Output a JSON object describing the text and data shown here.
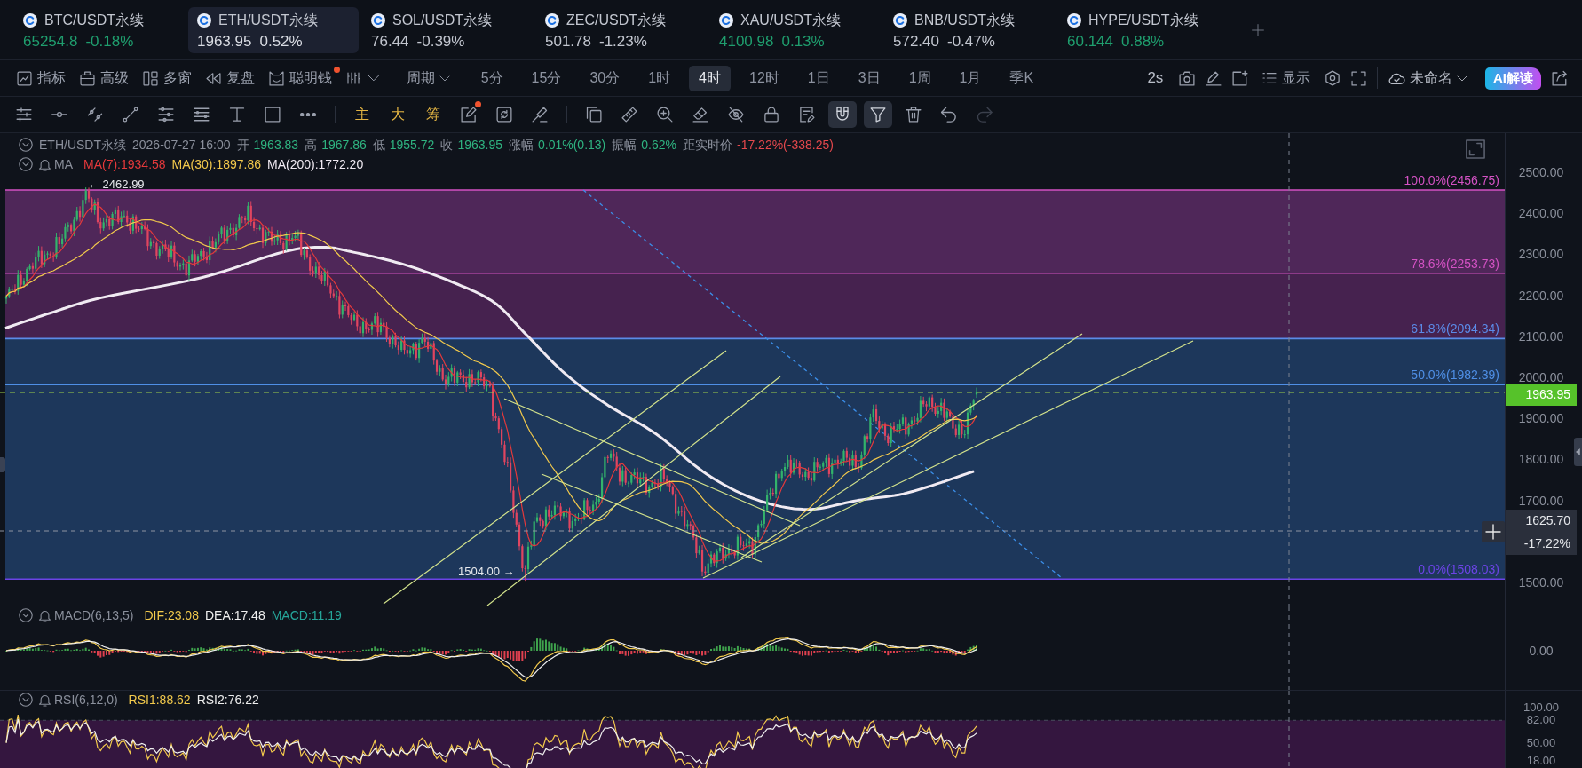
{
  "tickers": [
    {
      "symbol": "BTC/USDT永续",
      "price": "65254.8",
      "change": "-0.18%",
      "color": "#1f9e6e",
      "selected": false
    },
    {
      "symbol": "ETH/USDT永续",
      "price": "1963.95",
      "change": "0.52%",
      "color": "#d9dce3",
      "selected": true
    },
    {
      "symbol": "SOL/USDT永续",
      "price": "76.44",
      "change": "-0.39%",
      "color": "#c2c6cf",
      "selected": false
    },
    {
      "symbol": "ZEC/USDT永续",
      "price": "501.78",
      "change": "-1.23%",
      "color": "#c2c6cf",
      "selected": false
    },
    {
      "symbol": "XAU/USDT永续",
      "price": "4100.98",
      "change": "0.13%",
      "color": "#1f9e6e",
      "selected": false
    },
    {
      "symbol": "BNB/USDT永续",
      "price": "572.40",
      "change": "-0.47%",
      "color": "#c2c6cf",
      "selected": false
    },
    {
      "symbol": "HYPE/USDT永续",
      "price": "60.144",
      "change": "0.88%",
      "color": "#1f9e6e",
      "selected": false
    }
  ],
  "menu": [
    {
      "label": "指标",
      "dot": false
    },
    {
      "label": "高级",
      "dot": false
    },
    {
      "label": "多窗",
      "dot": false
    },
    {
      "label": "复盘",
      "dot": false
    },
    {
      "label": "聪明钱",
      "dot": true
    }
  ],
  "period_menu": {
    "label": "周期"
  },
  "periods": [
    {
      "label": "5分",
      "selected": false
    },
    {
      "label": "15分",
      "selected": false
    },
    {
      "label": "30分",
      "selected": false
    },
    {
      "label": "1时",
      "selected": false
    },
    {
      "label": "4时",
      "selected": true
    },
    {
      "label": "12时",
      "selected": false
    },
    {
      "label": "1日",
      "selected": false
    },
    {
      "label": "3日",
      "selected": false
    },
    {
      "label": "1周",
      "selected": false
    },
    {
      "label": "1月",
      "selected": false
    },
    {
      "label": "季K",
      "selected": false
    }
  ],
  "interval_button": {
    "label": "2s"
  },
  "display_button": {
    "label": "显示"
  },
  "layout_menu": {
    "label": "未命名"
  },
  "ai_button": {
    "label": "AI解读"
  },
  "tools": [
    {
      "kind": "icon",
      "on": false,
      "disabled": false,
      "dot": false
    },
    {
      "kind": "icon",
      "on": false,
      "disabled": false,
      "dot": false
    },
    {
      "kind": "icon",
      "on": false,
      "disabled": false,
      "dot": false
    },
    {
      "kind": "icon",
      "on": false,
      "disabled": false,
      "dot": false
    },
    {
      "kind": "icon",
      "on": false,
      "disabled": false,
      "dot": false
    },
    {
      "kind": "icon",
      "on": false,
      "disabled": false,
      "dot": false
    },
    {
      "kind": "icon",
      "on": false,
      "disabled": false,
      "dot": false
    },
    {
      "kind": "icon",
      "on": false,
      "disabled": false,
      "dot": false
    },
    {
      "kind": "icon",
      "on": false,
      "disabled": false,
      "dot": false
    },
    {
      "kind": "text",
      "label": "主",
      "on": false,
      "disabled": false,
      "dot": false
    },
    {
      "kind": "text",
      "label": "大",
      "on": false,
      "disabled": false,
      "dot": false
    },
    {
      "kind": "text",
      "label": "筹",
      "on": false,
      "disabled": false,
      "dot": false
    },
    {
      "kind": "icon",
      "on": false,
      "disabled": false,
      "dot": true
    },
    {
      "kind": "icon",
      "on": false,
      "disabled": false,
      "dot": false
    },
    {
      "kind": "icon",
      "on": false,
      "disabled": false,
      "dot": false
    },
    {
      "kind": "icon",
      "on": false,
      "disabled": false,
      "dot": false
    },
    {
      "kind": "icon",
      "on": false,
      "disabled": false,
      "dot": false
    },
    {
      "kind": "icon",
      "on": false,
      "disabled": false,
      "dot": false
    },
    {
      "kind": "icon",
      "on": false,
      "disabled": false,
      "dot": false
    },
    {
      "kind": "icon",
      "on": false,
      "disabled": false,
      "dot": false
    },
    {
      "kind": "icon",
      "on": false,
      "disabled": false,
      "dot": false
    },
    {
      "kind": "icon",
      "on": false,
      "disabled": false,
      "dot": false
    },
    {
      "kind": "icon",
      "on": true,
      "disabled": false,
      "dot": false
    },
    {
      "kind": "icon",
      "on": true,
      "disabled": false,
      "dot": false
    },
    {
      "kind": "icon",
      "on": false,
      "disabled": false,
      "dot": false
    },
    {
      "kind": "icon",
      "on": false,
      "disabled": false,
      "dot": false
    },
    {
      "kind": "icon",
      "on": false,
      "disabled": true,
      "dot": false
    }
  ],
  "legend": {
    "symbol": "ETH/USDT永续",
    "time": "2026-07-27 16:00",
    "fields": [
      {
        "label": "开",
        "value": "1963.83",
        "color": "#2fb380"
      },
      {
        "label": "高",
        "value": "1967.86",
        "color": "#2fb380"
      },
      {
        "label": "低",
        "value": "1955.72",
        "color": "#2fb380"
      },
      {
        "label": "收",
        "value": "1963.95",
        "color": "#2fb380"
      },
      {
        "label": "涨幅",
        "value": "0.01%(0.13)",
        "color": "#2fb380"
      },
      {
        "label": "振幅",
        "value": "0.62%",
        "color": "#2fb380"
      },
      {
        "label": "距实时价",
        "value": "-17.22%(-338.25)",
        "color": "#e5484d"
      }
    ]
  },
  "ma": {
    "label": "MA",
    "lines": [
      {
        "text": "MA(7):1934.58",
        "color": "#e5393b"
      },
      {
        "text": "MA(30):1897.86",
        "color": "#f2c94c"
      },
      {
        "text": "MA(200):1772.20",
        "color": "#f0eaf2"
      }
    ]
  },
  "fib_levels": [
    {
      "label": "100.0%(2456.75)",
      "color": "#d452c4"
    },
    {
      "label": "78.6%(2253.73)",
      "color": "#d452c4"
    },
    {
      "label": "61.8%(2094.34)",
      "color": "#5b8be8"
    },
    {
      "label": "50.0%(1982.39)",
      "color": "#4f8fe6"
    },
    {
      "label": "0.0%(1508.03)",
      "color": "#6c44e6"
    }
  ],
  "markers": {
    "high": "← 2462.99",
    "low": "1504.00 →"
  },
  "price_axis": {
    "ticks": [
      "2500.00",
      "2400.00",
      "2300.00",
      "2200.00",
      "2100.00",
      "2000.00",
      "1900.00",
      "1800.00",
      "1700.00",
      "1500.00"
    ]
  },
  "last_price": {
    "label": "1963.95"
  },
  "crosshair": {
    "price": "1625.70",
    "change": "-17.22%"
  },
  "macd": {
    "title": "MACD(6,13,5)",
    "values": [
      {
        "text": "DIF:23.08",
        "color": "#f2c94c"
      },
      {
        "text": "DEA:17.48",
        "color": "#eeeeee"
      },
      {
        "text": "MACD:11.19",
        "color": "#26a69a"
      }
    ],
    "ticks": [
      "0.00"
    ]
  },
  "rsi": {
    "title": "RSI(6,12,0)",
    "values": [
      {
        "text": "RSI1:88.62",
        "color": "#f2c94c"
      },
      {
        "text": "RSI2:76.22",
        "color": "#eeeeee"
      }
    ],
    "ticks": [
      "100.00",
      "82.00",
      "50.00",
      "18.00"
    ]
  }
}
